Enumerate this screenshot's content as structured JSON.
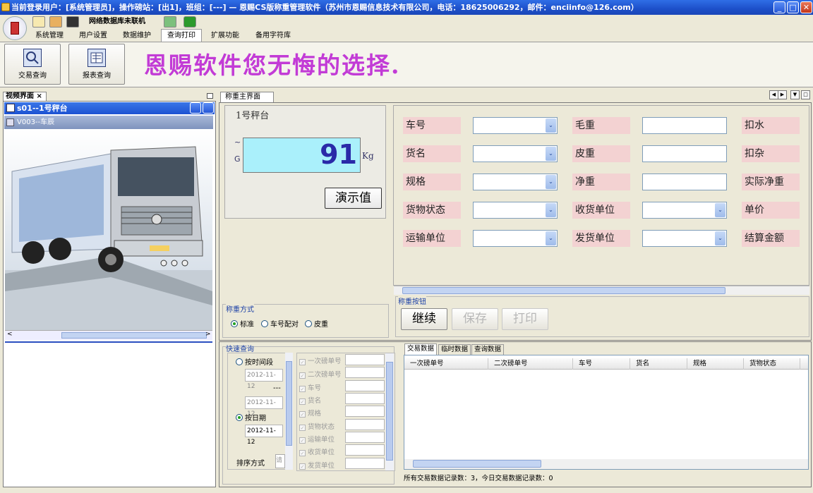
{
  "window": {
    "title": "当前登录用户：[系统管理员]，操作磅站：[出1]，班组：[---]  —  恩赐CS版称重管理软件（苏州市恩赐信息技术有限公司，电话：18625006292，邮件：enciinfo@126.com）",
    "min_label": "_",
    "max_label": "□",
    "close_label": "✕"
  },
  "toolbar": {
    "network_status": "网络数据库未联机"
  },
  "menu": {
    "tabs": [
      "系统管理",
      "用户设置",
      "数据维护",
      "查询打印",
      "扩展功能",
      "备用字符库"
    ],
    "active": "查询打印"
  },
  "ribbon": {
    "buttons": [
      "交易查询",
      "报表查询"
    ],
    "slogan": "恩赐软件您无悔的选择."
  },
  "video": {
    "tab_label": "视频界面",
    "tab_close": "×",
    "subwindow_title": "s01--1号秤台",
    "camera_label": "V003--车辰",
    "scroll_left": "<",
    "scroll_right": ">"
  },
  "weigh": {
    "tab_label": "称重主界面",
    "scale_name": "1号秤台",
    "display_value": "91",
    "unit": "Kg",
    "tilde": "~",
    "g_label": "G",
    "demo_button": "演示值",
    "mode_group_label": "称重方式",
    "modes": [
      "标准",
      "车号配对",
      "皮重"
    ],
    "mode_selected": "标准"
  },
  "fields": {
    "col1": [
      "车号",
      "货名",
      "规格",
      "货物状态",
      "运输单位"
    ],
    "col2": [
      "毛重",
      "皮重",
      "净重",
      "收货单位",
      "发货单位"
    ],
    "col3": [
      "扣水",
      "扣杂",
      "实际净重",
      "单价",
      "结算金额"
    ],
    "arrow": "⌄"
  },
  "buttons": {
    "group_label": "称重按钮",
    "continue": "继续",
    "save": "保存",
    "print": "打印"
  },
  "query": {
    "group_label": "快速查询",
    "by_period": "按时间段",
    "date_from": "2012-11-12",
    "dash": "---",
    "date_to": "2012-11-12",
    "by_date": "按日期",
    "date_single": "2012-11-12",
    "sort_label": "排序方式",
    "sort_value": "请",
    "checkboxes": [
      "一次磅单号",
      "二次磅单号",
      "车号",
      "货名",
      "规格",
      "货物状态",
      "运输单位",
      "收货单位",
      "发货单位"
    ]
  },
  "data_tabs": [
    "交易数据",
    "临时数据",
    "查询数据"
  ],
  "grid": {
    "columns": [
      "一次磅单号",
      "二次磅单号",
      "车号",
      "货名",
      "规格",
      "货物状态"
    ],
    "status": "所有交易数据记录数：3，今日交易数据记录数：0"
  },
  "colors": {
    "title_bar": "#1d4fc9",
    "slogan": "#c23bd6",
    "display_bg": "#aaf0fb",
    "display_text": "#2a2aa8",
    "field_label_bg": "#f3d2d2"
  }
}
